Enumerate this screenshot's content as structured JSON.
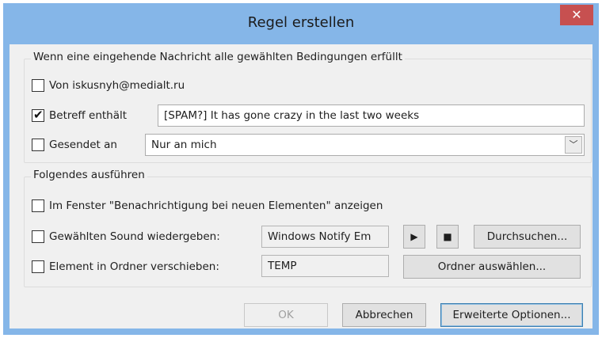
{
  "window": {
    "title": "Regel erstellen",
    "close_symbol": "✕"
  },
  "conditions": {
    "legend": "Wenn eine eingehende Nachricht alle gewählten Bedingungen erfüllt",
    "from": {
      "label": "Von iskusnyh@medialt.ru",
      "checked": false
    },
    "subject": {
      "label": "Betreff enthält",
      "checked": true,
      "value": "[SPAM?] It has gone crazy in the last two weeks"
    },
    "sent_to": {
      "label": "Gesendet an",
      "checked": false,
      "value": "Nur an mich"
    }
  },
  "actions": {
    "legend": "Folgendes ausführen",
    "notify": {
      "label": "Im Fenster \"Benachrichtigung bei neuen Elementen\" anzeigen",
      "checked": false
    },
    "sound": {
      "label": "Gewählten Sound wiedergeben:",
      "checked": false,
      "value": "Windows Notify Em",
      "play_icon": "▶",
      "stop_icon": "■",
      "browse_label": "Durchsuchen..."
    },
    "move": {
      "label": "Element in Ordner verschieben:",
      "checked": false,
      "value": "TEMP",
      "select_label": "Ordner auswählen..."
    }
  },
  "buttons": {
    "ok": "OK",
    "cancel": "Abbrechen",
    "advanced": "Erweiterte Optionen..."
  },
  "icons": {
    "checkmark": "✔",
    "dropdown_arrow": "﹀"
  },
  "colors": {
    "window_frame": "#85b6e8",
    "close_button": "#c75050",
    "dialog_background": "#f0f0f0"
  }
}
